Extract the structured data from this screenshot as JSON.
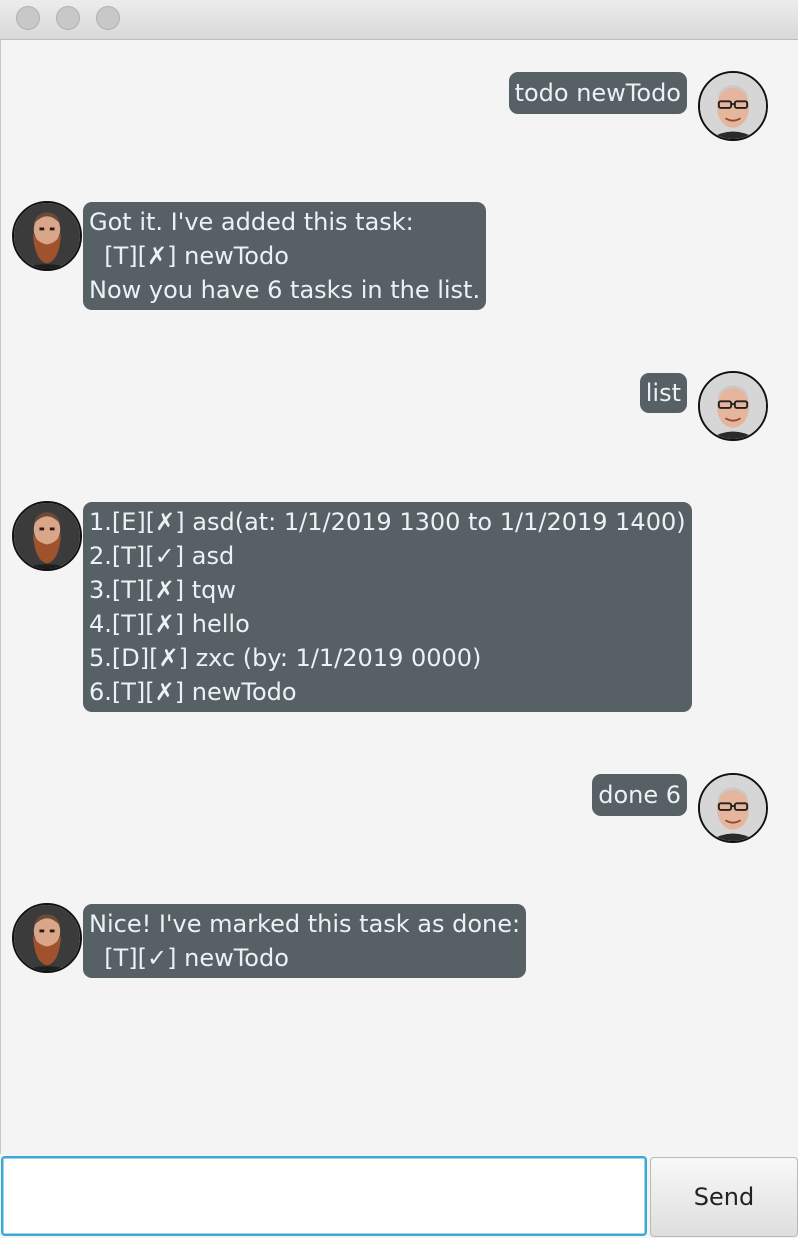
{
  "window": {
    "title": ""
  },
  "messages": [
    {
      "sender": "user",
      "text": "todo newTodo"
    },
    {
      "sender": "bot",
      "text": "Got it. I've added this task:\n  [T][✗] newTodo\nNow you have 6 tasks in the list."
    },
    {
      "sender": "user",
      "text": "list"
    },
    {
      "sender": "bot",
      "text": "1.[E][✗] asd(at: 1/1/2019 1300 to 1/1/2019 1400)\n2.[T][✓] asd\n3.[T][✗] tqw\n4.[T][✗] hello\n5.[D][✗] zxc (by: 1/1/2019 0000)\n6.[T][✗] newTodo"
    },
    {
      "sender": "user",
      "text": "done 6"
    },
    {
      "sender": "bot",
      "text": "Nice! I've marked this task as done:\n  [T][✓] newTodo"
    }
  ],
  "input": {
    "value": "",
    "placeholder": ""
  },
  "send_button": {
    "label": "Send"
  },
  "colors": {
    "bubble_bg": "#566065",
    "bubble_text": "#e9f2f4",
    "chat_bg": "#f4f4f4",
    "input_focus": "#3da7d8"
  },
  "icons": {
    "user_avatar": "user-avatar-icon",
    "bot_avatar": "bot-avatar-icon"
  }
}
